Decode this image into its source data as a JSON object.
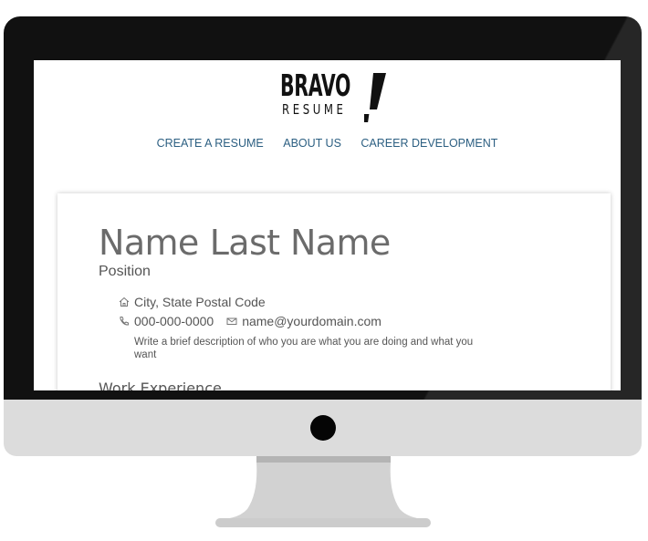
{
  "brand": {
    "logo_top": "BRAVO",
    "logo_bottom": "RESUME"
  },
  "nav": {
    "items": [
      "CREATE A RESUME",
      "ABOUT US",
      "CAREER DEVELOPMENT"
    ]
  },
  "resume": {
    "first_name": "Name",
    "last_name": "Last Name",
    "position": "Position",
    "address": "City, State Postal Code",
    "phone": "000-000-0000",
    "email": "name@yourdomain.com",
    "description": "Write a brief description of who you are what you are doing and what you want",
    "section_heading": "Work Experience"
  },
  "icons": {
    "address": "home-icon",
    "phone": "phone-icon",
    "email": "envelope-icon"
  },
  "colors": {
    "nav_link": "#2c5f82",
    "bezel": "#111111",
    "chin": "#dcdcdc",
    "stand": "#d2d2d2"
  }
}
